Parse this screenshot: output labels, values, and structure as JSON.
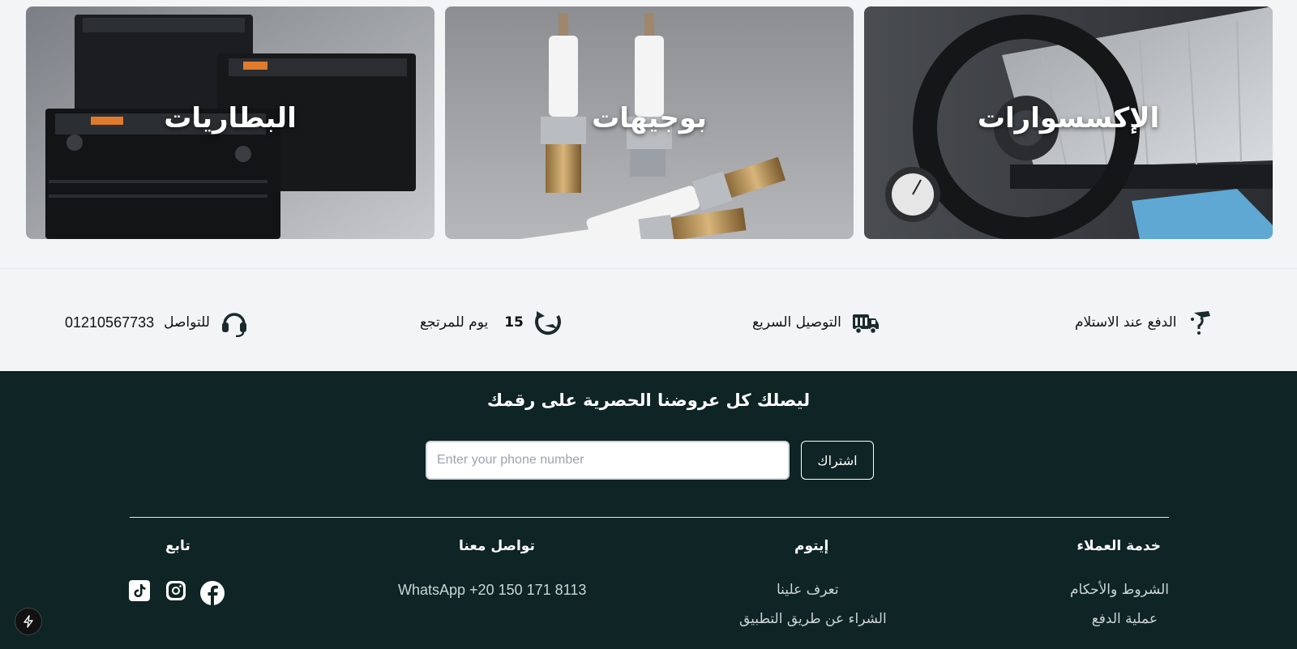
{
  "categories": [
    {
      "label": "البطاريات",
      "icon": "battery-image"
    },
    {
      "label": "بوجيهات",
      "icon": "spark-plug-image"
    },
    {
      "label": "الإكسسوارات",
      "icon": "steering-wheel-image"
    }
  ],
  "features": {
    "contact": {
      "label": "للتواصل",
      "phone": "01210567733",
      "icon": "headset-icon"
    },
    "returns": {
      "number": "15",
      "label": "يوم للمرتجع",
      "icon": "return-arrow-icon"
    },
    "delivery": {
      "label": "التوصيل السريع",
      "icon": "delivery-truck-icon"
    },
    "cod": {
      "label": "الدفع عند الاستلام",
      "icon": "hand-money-icon"
    }
  },
  "newsletter": {
    "title": "ليصلك كل عروضنا الحصرية على رقمك",
    "placeholder": "Enter your phone number",
    "button": "اشتراك"
  },
  "footer": {
    "customer_service": {
      "title": "خدمة العملاء",
      "links": [
        "الشروط والأحكام",
        "عملية الدفع"
      ]
    },
    "company": {
      "title": "إيتوم",
      "links": [
        "تعرف علينا",
        "الشراء عن طريق التطبيق"
      ]
    },
    "contact": {
      "title": "تواصل معنا",
      "whatsapp": "WhatsApp +20 150 171 8113"
    },
    "follow": {
      "title": "تابع",
      "icons": [
        "facebook-icon",
        "instagram-icon",
        "tiktok-icon"
      ]
    }
  },
  "colors": {
    "footer_bg": "#0f2424",
    "page_bg": "#f3f4f6"
  }
}
